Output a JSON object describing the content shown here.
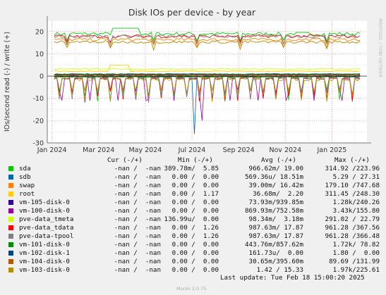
{
  "chart_data": {
    "type": "line",
    "title": "Disk IOs per device - by year",
    "ylabel": "IOs/second read (-) / write (+)",
    "watermark": "RRDTOOL / TOBI OETIKER",
    "ylim": [
      -30,
      25
    ],
    "yticks": [
      20,
      10,
      0,
      -10,
      -20,
      -30
    ],
    "xticks": [
      "Jan 2024",
      "Mar 2024",
      "May 2024",
      "Jul 2024",
      "Sep 2024",
      "Nov 2024",
      "Jan 2025"
    ],
    "x_months": [
      0,
      2,
      4,
      6,
      8,
      10,
      12
    ],
    "xlim_months": [
      -0.2,
      13.5
    ],
    "grid": true,
    "series": [
      {
        "name": "sda",
        "color": "#00cc00",
        "write_level": 19.0,
        "read_level": -0.97
      },
      {
        "name": "sdb",
        "color": "#0066b3",
        "write_level": 0.57,
        "read_level": -18.5
      },
      {
        "name": "swap",
        "color": "#ff8000",
        "write_level": 16.4,
        "read_level": -0.03
      },
      {
        "name": "root",
        "color": "#ffcc00",
        "write_level": 2.2,
        "read_level": -0.04
      },
      {
        "name": "vm-105-disk-0",
        "color": "#330099",
        "write_level": 0.94,
        "read_level": -0.07
      },
      {
        "name": "vm-100-disk-0",
        "color": "#990099",
        "write_level": 0.75,
        "read_level": -0.87
      },
      {
        "name": "pve-data_tmeta",
        "color": "#ccff00",
        "write_level": 3.18,
        "read_level": -0.1
      },
      {
        "name": "pve-data_tdata",
        "color": "#ff0000",
        "write_level": 17.87,
        "read_level": -0.99
      },
      {
        "name": "pve-data-tpool",
        "color": "#808080",
        "write_level": 17.87,
        "read_level": -0.99
      },
      {
        "name": "vm-101-disk-0",
        "color": "#008f00",
        "write_level": 0.86,
        "read_level": -0.44
      },
      {
        "name": "vm-102-disk-1",
        "color": "#00487d",
        "write_level": 0.0,
        "read_level": -0.16
      },
      {
        "name": "vm-104-disk-0",
        "color": "#b35a00",
        "write_level": 0.4,
        "read_level": -0.03
      },
      {
        "name": "vm-103-disk-0",
        "color": "#b38f00",
        "write_level": 15.33,
        "read_level": -1.42
      }
    ]
  },
  "legend": {
    "headers": {
      "cur": "Cur (-/+)",
      "min": "Min (-/+)",
      "avg": "Avg (-/+)",
      "max": "Max (-/+)"
    },
    "rows": [
      {
        "name": "sda",
        "color": "#00cc00",
        "cur": "-nan /  -nan",
        "min": "389.78m/  5.85",
        "avg": "966.62m/ 19.00",
        "max": "314.92 /223.96"
      },
      {
        "name": "sdb",
        "color": "#0066b3",
        "cur": "-nan /  -nan",
        "min": "0.00 /  0.00",
        "avg": "569.36u/ 18.51m",
        "max": "5.29 / 27.31"
      },
      {
        "name": "swap",
        "color": "#ff8000",
        "cur": "-nan /  -nan",
        "min": "0.00 /  0.00",
        "avg": "39.00m/ 16.42m",
        "max": "179.10 /747.68"
      },
      {
        "name": "root",
        "color": "#ffcc00",
        "cur": "-nan /  -nan",
        "min": "0.00 /  1.17",
        "avg": "36.68m/  2.20",
        "max": "311.45 /248.30"
      },
      {
        "name": "vm-105-disk-0",
        "color": "#330099",
        "cur": "-nan /  -nan",
        "min": "0.00 /  0.00",
        "avg": "73.93m/939.85m",
        "max": "1.28k/240.26"
      },
      {
        "name": "vm-100-disk-0",
        "color": "#990099",
        "cur": "-nan /  -nan",
        "min": "0.00 /  0.00",
        "avg": "869.93m/752.58m",
        "max": "3.43k/155.80"
      },
      {
        "name": "pve-data_tmeta",
        "color": "#ccff00",
        "cur": "-nan /  -nan",
        "min": "136.99u/  0.00",
        "avg": "98.34m/  3.18m",
        "max": "291.02 / 22.79"
      },
      {
        "name": "pve-data_tdata",
        "color": "#ff0000",
        "cur": "-nan /  -nan",
        "min": "0.00 /  1.26",
        "avg": "987.63m/ 17.87",
        "max": "961.28 /367.56"
      },
      {
        "name": "pve-data-tpool",
        "color": "#808080",
        "cur": "-nan /  -nan",
        "min": "0.00 /  1.26",
        "avg": "987.63m/ 17.87",
        "max": "961.28 /366.48"
      },
      {
        "name": "vm-101-disk-0",
        "color": "#008f00",
        "cur": "-nan /  -nan",
        "min": "0.00 /  0.00",
        "avg": "443.76m/857.62m",
        "max": "1.72k/ 78.82"
      },
      {
        "name": "vm-102-disk-1",
        "color": "#00487d",
        "cur": "-nan /  -nan",
        "min": "0.00 /  0.00",
        "avg": "161.73u/  0.00",
        "max": "1.80 /  0.00"
      },
      {
        "name": "vm-104-disk-0",
        "color": "#b35a00",
        "cur": "-nan /  -nan",
        "min": "0.00 /  0.00",
        "avg": "30.65m/395.60m",
        "max": "89.69 /131.99"
      },
      {
        "name": "vm-103-disk-0",
        "color": "#b38f00",
        "cur": "-nan /  -nan",
        "min": "0.00 /  0.00",
        "avg": "1.42 / 15.33",
        "max": "1.97k/225.61"
      }
    ]
  },
  "footer": {
    "last_update": "Last update: Tue Feb 18 15:00:20 2025",
    "generator": "Munin 2.0.75"
  }
}
